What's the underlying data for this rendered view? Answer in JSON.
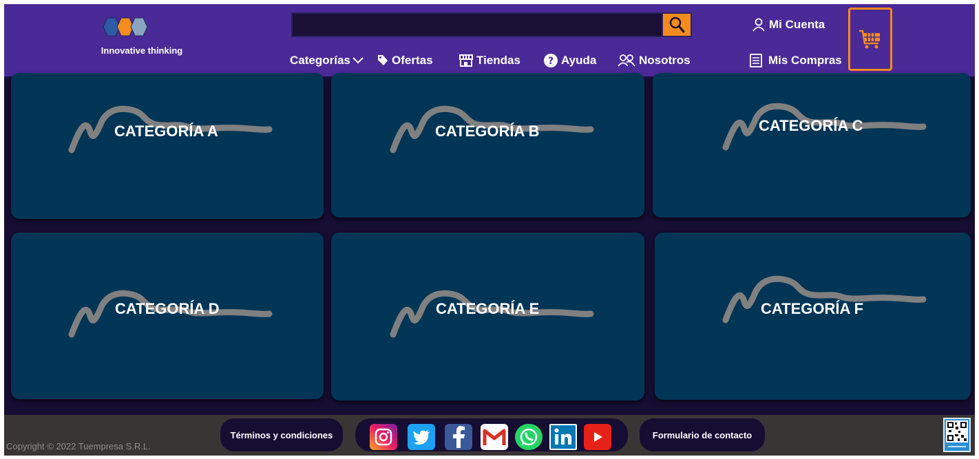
{
  "header": {
    "tagline": "Innovative thinking",
    "search": {
      "placeholder": ""
    },
    "nav": [
      {
        "label": "Categorías",
        "icon": "chevron-down-icon"
      },
      {
        "label": "Ofertas",
        "icon": "tag-icon"
      },
      {
        "label": "Tiendas",
        "icon": "store-icon"
      },
      {
        "label": "Ayuda",
        "icon": "help-icon"
      },
      {
        "label": "Nosotros",
        "icon": "people-icon"
      }
    ],
    "account": {
      "label": "Mi Cuenta",
      "icon": "user-icon"
    },
    "purchases": {
      "label": "Mis Compras",
      "icon": "receipt-icon"
    },
    "cart_icon": "cart-icon"
  },
  "categories": [
    {
      "label": "CATEGORÍA A"
    },
    {
      "label": "CATEGORÍA B"
    },
    {
      "label": "CATEGORÍA C"
    },
    {
      "label": "CATEGORÍA D"
    },
    {
      "label": "CATEGORÍA E"
    },
    {
      "label": "CATEGORÍA F"
    }
  ],
  "footer": {
    "copyright": "Copyright © 2022 Tuempresa S.R.L.",
    "terms": "Términos y condiciones",
    "contact": "Formulario de contacto",
    "social": [
      "instagram-icon",
      "twitter-icon",
      "facebook-icon",
      "gmail-icon",
      "whatsapp-icon",
      "linkedin-icon",
      "youtube-icon"
    ],
    "qr_icon": "data-fiscal-qr-icon"
  },
  "colors": {
    "header_bg": "#4a2a96",
    "page_bg": "#160d33",
    "card_bg": "#003556",
    "accent": "#f68b1f",
    "footer_bg": "#3a3535"
  }
}
